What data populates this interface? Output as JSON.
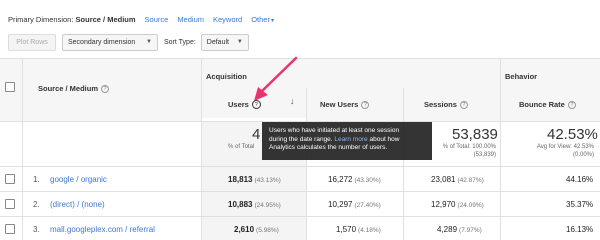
{
  "dimension_bar": {
    "primary_label": "Primary Dimension:",
    "primary_value": "Source / Medium",
    "options": [
      "Source",
      "Medium",
      "Keyword",
      "Other"
    ]
  },
  "toolbar": {
    "plot_rows": "Plot Rows",
    "secondary_dimension": "Secondary dimension",
    "sort_type_label": "Sort Type:",
    "sort_type_value": "Default"
  },
  "table": {
    "group_acquisition": "Acquisition",
    "group_behavior": "Behavior",
    "col_source": "Source / Medium",
    "col_users": "Users",
    "col_new_users": "New Users",
    "col_sessions": "Sessions",
    "col_bounce": "Bounce Rate",
    "totals": {
      "users_partial": "4",
      "users_sub": "% of Total",
      "sessions": "53,839",
      "sessions_sub1": "% of Total: 100.00%",
      "sessions_sub2": "(53,839)",
      "bounce": "42.53%",
      "bounce_sub1": "Avg for View: 42.53%",
      "bounce_sub2": "(0.00%)"
    },
    "rows": [
      {
        "num": "1.",
        "source": "google / organic",
        "users": "18,813",
        "users_pct": "(43.13%)",
        "new_users": "16,272",
        "new_users_pct": "(43.30%)",
        "sessions": "23,081",
        "sessions_pct": "(42.87%)",
        "bounce": "44.16%"
      },
      {
        "num": "2.",
        "source": "(direct) / (none)",
        "users": "10,883",
        "users_pct": "(24.95%)",
        "new_users": "10,297",
        "new_users_pct": "(27.40%)",
        "sessions": "12,970",
        "sessions_pct": "(24.09%)",
        "bounce": "35.37%"
      },
      {
        "num": "3.",
        "source": "mall.googleplex.com / referral",
        "users": "2,610",
        "users_pct": "(5.98%)",
        "new_users": "1,570",
        "new_users_pct": "(4.18%)",
        "sessions": "4,289",
        "sessions_pct": "(7.97%)",
        "bounce": "16.13%"
      }
    ]
  },
  "tooltip": {
    "line1": "Users who have initiated at least one session",
    "line2_pre": "during the date range.",
    "line2_link": "Learn more",
    "line2_post": "about how",
    "line3": "Analytics calculates the number of users."
  },
  "colors": {
    "link": "#3c78d8",
    "arrow": "#e8336f"
  }
}
